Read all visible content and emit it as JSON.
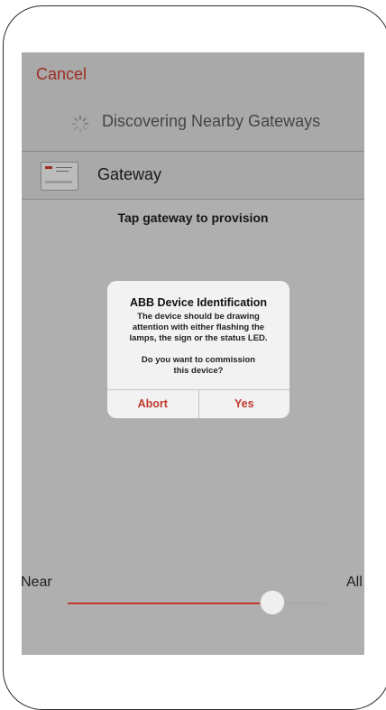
{
  "nav": {
    "cancel_label": "Cancel"
  },
  "discovery": {
    "label": "Discovering Nearby Gateways",
    "icon": "spinner-icon"
  },
  "gateway_list": [
    {
      "label": "Gateway",
      "icon": "gateway-thumbnail"
    }
  ],
  "hint": "Tap gateway to provision",
  "dialog": {
    "title": "ABB Device Identification",
    "message_line1": "The device should be drawing",
    "message_line2": "attention with either flashing the",
    "message_line3": "lamps, the sign or the status LED.",
    "question_line1": "Do you want to commission",
    "question_line2": "this device?",
    "abort_label": "Abort",
    "yes_label": "Yes"
  },
  "range_slider": {
    "min_label": "Near",
    "max_label": "All",
    "value_fraction": 0.79
  },
  "colors": {
    "accent": "#c0392b",
    "background": "#d6d6d6",
    "dialog_background": "#f2f2f2"
  }
}
